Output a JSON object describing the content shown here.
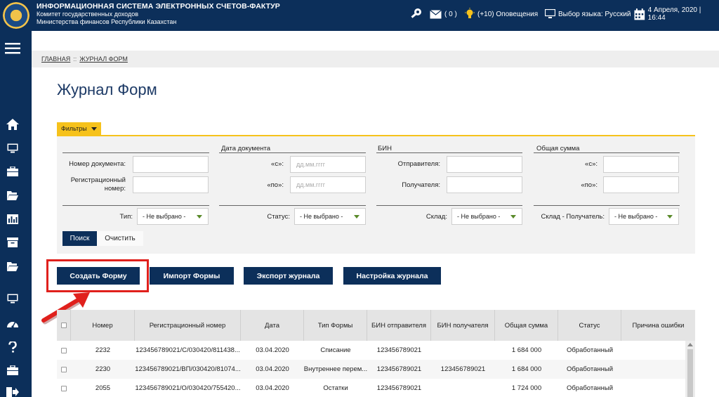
{
  "header": {
    "title": "ИНФОРМАЦИОННАЯ СИСТЕМА ЭЛЕКТРОННЫХ СЧЕТОВ-ФАКТУР",
    "subtitle1": "Комитет государственных доходов",
    "subtitle2": "Министерства финансов Республики Казахстан",
    "messages": "( 0 )",
    "notifications": "(+10) Оповещения",
    "language": "Выбор языка: Русский",
    "datetime": "4 Апреля, 2020 | 16:44"
  },
  "breadcrumb": {
    "home": "ГЛАВНАЯ",
    "sep": "::",
    "current": "ЖУРНАЛ ФОРМ"
  },
  "page_title": "Журнал Форм",
  "filters": {
    "tab_label": "Фильтры",
    "groups": {
      "date": "Дата документа",
      "bin": "БИН",
      "sum": "Общая сумма"
    },
    "doc_number_label": "Номер документа:",
    "reg_number_label": "Регистрационный номер:",
    "from_label": "«с»:",
    "to_label": "«по»:",
    "date_placeholder": "дд.мм.гггг",
    "sender_label": "Отправителя:",
    "receiver_label": "Получателя:",
    "type_label": "Тип:",
    "status_label": "Статус:",
    "warehouse_label": "Склад:",
    "warehouse_receiver_label": "Склад - Получатель:",
    "not_selected": "- Не выбрано -",
    "search": "Поиск",
    "clear": "Очистить"
  },
  "actions": {
    "create": "Создать Форму",
    "import": "Импорт Формы",
    "export": "Экспорт журнала",
    "settings": "Настройка журнала"
  },
  "table": {
    "columns": [
      "Номер",
      "Регистрационный номер",
      "Дата",
      "Тип Формы",
      "БИН отправителя",
      "БИН получателя",
      "Общая сумма",
      "Статус",
      "Причина ошибки"
    ],
    "rows": [
      [
        "2232",
        "123456789021/С/030420/811438...",
        "03.04.2020",
        "Списание",
        "123456789021",
        "",
        "1 684 000",
        "Обработанный",
        ""
      ],
      [
        "2230",
        "123456789021/ВП/030420/81074...",
        "03.04.2020",
        "Внутреннее перем...",
        "123456789021",
        "123456789021",
        "1 684 000",
        "Обработанный",
        ""
      ],
      [
        "2055",
        "123456789021/О/030420/755420...",
        "03.04.2020",
        "Остатки",
        "123456789021",
        "",
        "1 724 000",
        "Обработанный",
        ""
      ]
    ]
  },
  "colors": {
    "navy": "#0c2f5a",
    "accent": "#f6c21c",
    "highlight": "#e0201c"
  }
}
